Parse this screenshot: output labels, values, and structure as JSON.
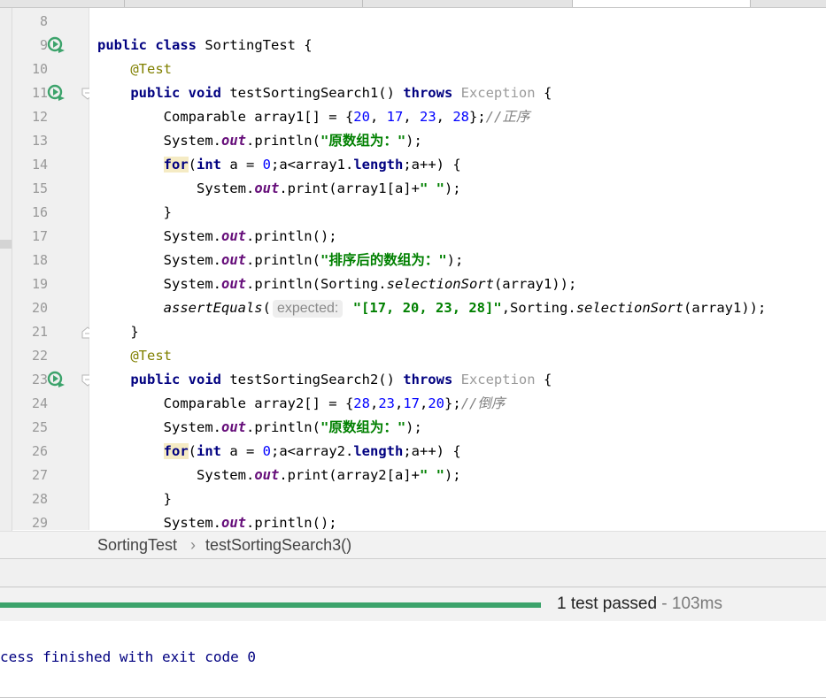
{
  "editor": {
    "lines": [
      {
        "n": "8",
        "tokens": []
      },
      {
        "n": "9",
        "tokens": [
          [
            "kw",
            "public class "
          ],
          [
            "",
            "SortingTest {"
          ]
        ]
      },
      {
        "n": "10",
        "tokens": [
          [
            "ann",
            "    @Test"
          ]
        ]
      },
      {
        "n": "11",
        "tokens": [
          [
            "kw",
            "    public void "
          ],
          [
            "",
            "testSortingSearch1() "
          ],
          [
            "kw",
            "throws "
          ],
          [
            "gray",
            "Exception "
          ],
          [
            "",
            "{"
          ]
        ]
      },
      {
        "n": "12",
        "tokens": [
          [
            "",
            "        Comparable array1[] = {"
          ],
          [
            "num",
            "20"
          ],
          [
            "",
            ", "
          ],
          [
            "num",
            "17"
          ],
          [
            "",
            ", "
          ],
          [
            "num",
            "23"
          ],
          [
            "",
            ", "
          ],
          [
            "num",
            "28"
          ],
          [
            "",
            "};"
          ],
          [
            "cmt",
            "//正序"
          ]
        ]
      },
      {
        "n": "13",
        "tokens": [
          [
            "",
            "        System."
          ],
          [
            "fld",
            "out"
          ],
          [
            "",
            ".println("
          ],
          [
            "str",
            "\"原数组为：\""
          ],
          [
            "",
            ");"
          ]
        ]
      },
      {
        "n": "14",
        "tokens": [
          [
            "",
            "        "
          ],
          [
            "kw hl",
            "for"
          ],
          [
            "",
            "("
          ],
          [
            "kw",
            "int "
          ],
          [
            "",
            "a = "
          ],
          [
            "num",
            "0"
          ],
          [
            "",
            ";a<array1."
          ],
          [
            "kw",
            "length"
          ],
          [
            "",
            ";a++) {"
          ]
        ]
      },
      {
        "n": "15",
        "tokens": [
          [
            "",
            "            System."
          ],
          [
            "fld",
            "out"
          ],
          [
            "",
            ".print(array1[a]+"
          ],
          [
            "str",
            "\" \""
          ],
          [
            "",
            ");"
          ]
        ]
      },
      {
        "n": "16",
        "tokens": [
          [
            "",
            "        }"
          ]
        ]
      },
      {
        "n": "17",
        "tokens": [
          [
            "",
            "        System."
          ],
          [
            "fld",
            "out"
          ],
          [
            "",
            ".println();"
          ]
        ]
      },
      {
        "n": "18",
        "tokens": [
          [
            "",
            "        System."
          ],
          [
            "fld",
            "out"
          ],
          [
            "",
            ".println("
          ],
          [
            "str",
            "\"排序后的数组为：\""
          ],
          [
            "",
            ");"
          ]
        ]
      },
      {
        "n": "19",
        "tokens": [
          [
            "",
            "        System."
          ],
          [
            "fld",
            "out"
          ],
          [
            "",
            ".println(Sorting."
          ],
          [
            "italic",
            "selectionSort"
          ],
          [
            "",
            "(array1));"
          ]
        ]
      },
      {
        "n": "20",
        "tokens": [
          [
            "",
            "        "
          ],
          [
            "italic",
            "assertEquals"
          ],
          [
            "",
            "("
          ],
          [
            "hint",
            "expected:"
          ],
          [
            "str",
            " \"[17, 20, 23, 28]\""
          ],
          [
            "",
            ",Sorting."
          ],
          [
            "italic",
            "selectionSort"
          ],
          [
            "",
            "(array1));"
          ]
        ]
      },
      {
        "n": "21",
        "tokens": [
          [
            "",
            "    }"
          ]
        ]
      },
      {
        "n": "22",
        "tokens": [
          [
            "ann",
            "    @Test"
          ]
        ]
      },
      {
        "n": "23",
        "tokens": [
          [
            "kw",
            "    public void "
          ],
          [
            "",
            "testSortingSearch2() "
          ],
          [
            "kw",
            "throws "
          ],
          [
            "gray",
            "Exception "
          ],
          [
            "",
            "{"
          ]
        ]
      },
      {
        "n": "24",
        "tokens": [
          [
            "",
            "        Comparable array2[] = {"
          ],
          [
            "num",
            "28"
          ],
          [
            "",
            ","
          ],
          [
            "num",
            "23"
          ],
          [
            "",
            ","
          ],
          [
            "num",
            "17"
          ],
          [
            "",
            ","
          ],
          [
            "num",
            "20"
          ],
          [
            "",
            "};"
          ],
          [
            "cmt",
            "//倒序"
          ]
        ]
      },
      {
        "n": "25",
        "tokens": [
          [
            "",
            "        System."
          ],
          [
            "fld",
            "out"
          ],
          [
            "",
            ".println("
          ],
          [
            "str",
            "\"原数组为：\""
          ],
          [
            "",
            ");"
          ]
        ]
      },
      {
        "n": "26",
        "tokens": [
          [
            "",
            "        "
          ],
          [
            "kw hl",
            "for"
          ],
          [
            "",
            "("
          ],
          [
            "kw",
            "int "
          ],
          [
            "",
            "a = "
          ],
          [
            "num",
            "0"
          ],
          [
            "",
            ";a<array2."
          ],
          [
            "kw",
            "length"
          ],
          [
            "",
            ";a++) {"
          ]
        ]
      },
      {
        "n": "27",
        "tokens": [
          [
            "",
            "            System."
          ],
          [
            "fld",
            "out"
          ],
          [
            "",
            ".print(array2[a]+"
          ],
          [
            "str",
            "\" \""
          ],
          [
            "",
            ");"
          ]
        ]
      },
      {
        "n": "28",
        "tokens": [
          [
            "",
            "        }"
          ]
        ]
      },
      {
        "n": "29",
        "tokens": [
          [
            "",
            "        System."
          ],
          [
            "fld",
            "out"
          ],
          [
            "",
            ".println();"
          ]
        ]
      }
    ],
    "run_icon_lines": [
      "9",
      "11",
      "23"
    ],
    "fold_open_lines": [
      "11",
      "23"
    ],
    "fold_close_lines": [
      "21"
    ]
  },
  "breadcrumb": {
    "class_name": "SortingTest",
    "separator": "›",
    "method_name": "testSortingSearch3()"
  },
  "test_status": {
    "result": "1 test passed",
    "separator": " - ",
    "duration": "103ms",
    "progress": 1.0,
    "progress_color": "#3ca36b"
  },
  "console": {
    "output": "cess finished with exit code 0"
  },
  "colors": {
    "keyword": "#000080",
    "annotation": "#808000",
    "number": "#0000ff",
    "string": "#008000",
    "comment": "#808080",
    "field": "#660e7a",
    "run_icon": "#3ca36b"
  }
}
